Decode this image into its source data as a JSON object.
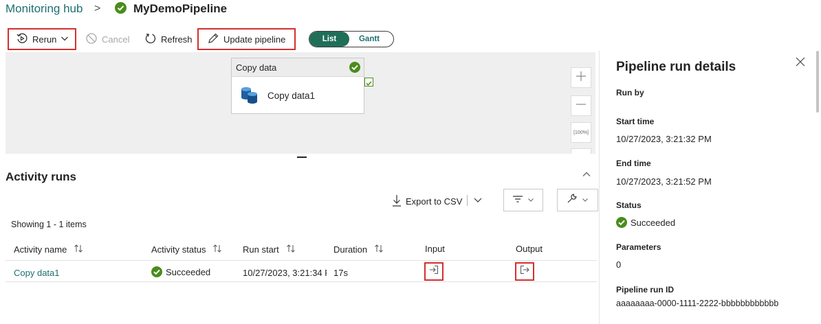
{
  "breadcrumb": {
    "hub": "Monitoring hub",
    "separator": ">",
    "pipeline": "MyDemoPipeline"
  },
  "toolbar": {
    "rerun": "Rerun",
    "cancel": "Cancel",
    "refresh": "Refresh",
    "update": "Update pipeline",
    "view_list": "List",
    "view_gantt": "Gantt"
  },
  "canvas": {
    "node_header": "Copy data",
    "node_activity": "Copy data1",
    "zoom_fit": "[100%]"
  },
  "activity_runs": {
    "title": "Activity runs",
    "export": "Export to CSV",
    "showing": "Showing 1 - 1 items",
    "columns": [
      "Activity name",
      "Activity status",
      "Run start",
      "Duration",
      "Input",
      "Output"
    ],
    "rows": [
      {
        "name": "Copy data1",
        "status": "Succeeded",
        "run_start": "10/27/2023, 3:21:34 F",
        "duration": "17s"
      }
    ]
  },
  "details": {
    "title": "Pipeline run details",
    "run_by_label": "Run by",
    "start_time_label": "Start time",
    "start_time": "10/27/2023, 3:21:32 PM",
    "end_time_label": "End time",
    "end_time": "10/27/2023, 3:21:52 PM",
    "status_label": "Status",
    "status": "Succeeded",
    "parameters_label": "Parameters",
    "parameters": "0",
    "run_id_label": "Pipeline run ID",
    "run_id": "aaaaaaaa-0000-1111-2222-bbbbbbbbbbbb"
  },
  "colors": {
    "accent": "#1f6f6f",
    "success": "#4a8c1c",
    "highlight": "#d32f2f",
    "toggle_active": "#1f6f58"
  },
  "icons": [
    "check-circle-icon",
    "rerun-icon",
    "chevron-down-icon",
    "cancel-icon",
    "refresh-icon",
    "pencil-icon",
    "database-icon",
    "zoom-in-icon",
    "zoom-out-icon",
    "fit-icon",
    "chevron-up-icon",
    "download-icon",
    "filter-icon",
    "wrench-icon",
    "sort-icon",
    "input-icon",
    "output-icon",
    "close-icon"
  ]
}
